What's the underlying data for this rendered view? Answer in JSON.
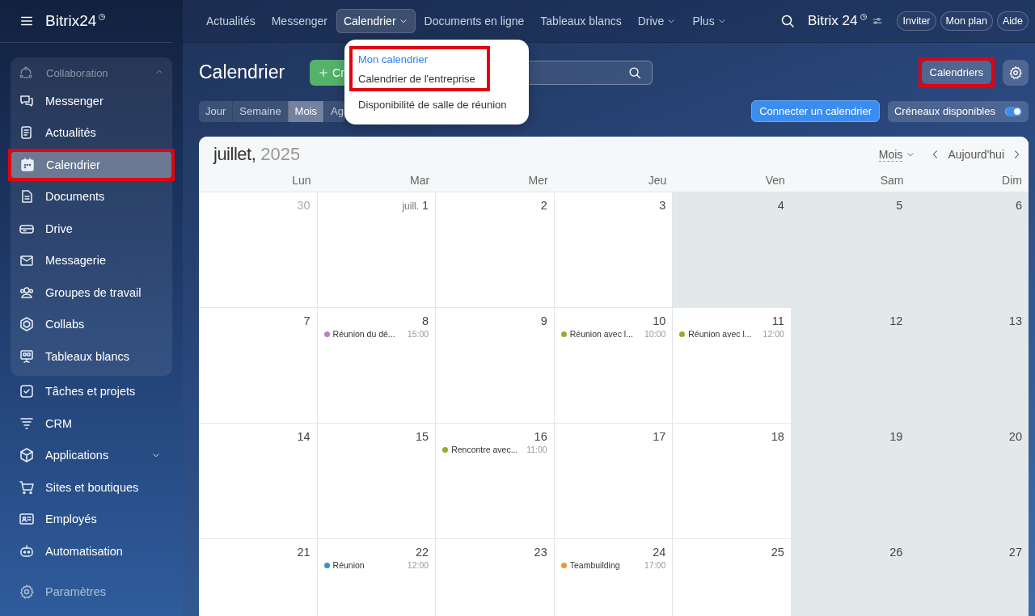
{
  "sidebar": {
    "logo": {
      "name": "Bitrix24"
    },
    "group": {
      "label": "Collaboration",
      "expanded": true,
      "items": [
        {
          "label": "Messenger",
          "selected": false,
          "highlighted": false
        },
        {
          "label": "Actualités",
          "selected": false,
          "highlighted": false
        },
        {
          "label": "Calendrier",
          "selected": true,
          "highlighted": true
        },
        {
          "label": "Documents",
          "selected": false,
          "highlighted": false
        },
        {
          "label": "Drive",
          "selected": false,
          "highlighted": false
        },
        {
          "label": "Messagerie",
          "selected": false,
          "highlighted": false
        },
        {
          "label": "Groupes de travail",
          "selected": false,
          "highlighted": false
        },
        {
          "label": "Collabs",
          "selected": false,
          "highlighted": false
        },
        {
          "label": "Tableaux blancs",
          "selected": false,
          "highlighted": false
        }
      ]
    },
    "items": [
      {
        "label": "Tâches et projets",
        "selected": false,
        "highlighted": false
      },
      {
        "label": "CRM",
        "selected": false,
        "highlighted": false
      },
      {
        "label": "Applications",
        "selected": false,
        "highlighted": false,
        "expanded": false
      },
      {
        "label": "Sites et boutiques",
        "selected": false,
        "highlighted": false
      },
      {
        "label": "Employés",
        "selected": false,
        "highlighted": false
      },
      {
        "label": "Automatisation",
        "selected": false,
        "highlighted": false
      }
    ],
    "settings": {
      "label": "Paramètres"
    }
  },
  "top_nav": {
    "items": [
      {
        "label": "Actualités",
        "selected": false,
        "has_menu": false
      },
      {
        "label": "Messenger",
        "selected": false,
        "has_menu": false
      },
      {
        "label": "Calendrier",
        "selected": true,
        "has_menu": true
      },
      {
        "label": "Documents en ligne",
        "selected": false,
        "has_menu": false
      },
      {
        "label": "Tableaux blancs",
        "selected": false,
        "has_menu": false
      },
      {
        "label": "Drive",
        "selected": false,
        "has_menu": true
      },
      {
        "label": "Plus",
        "selected": false,
        "has_menu": true
      }
    ],
    "brand": {
      "name": "Bitrix",
      "number": "24"
    },
    "buttons": [
      "Inviter",
      "Mon plan",
      "Aide"
    ]
  },
  "dropdown": {
    "items": [
      {
        "label": "Mon calendrier",
        "selected": true,
        "highlighted": true
      },
      {
        "label": "Calendrier de l'entreprise",
        "selected": false,
        "highlighted": true
      },
      {
        "label": "Disponibilité de salle de réunion",
        "selected": false,
        "highlighted": false
      }
    ]
  },
  "toolbar": {
    "title": "Calendrier",
    "create_button": "Cr",
    "calendars_button": {
      "label": "Calendriers",
      "highlighted": true
    },
    "view_tabs": [
      {
        "label": "Jour",
        "selected": false
      },
      {
        "label": "Semaine",
        "selected": false
      },
      {
        "label": "Mois",
        "selected": true
      },
      {
        "label": "Ag",
        "selected": false
      }
    ],
    "connect_button": "Connecter un calendrier",
    "slots_toggle": {
      "label": "Créneaux disponibles",
      "on": true
    }
  },
  "calendar": {
    "month": "juillet,",
    "year": "2025",
    "view": "Mois",
    "today": "Aujourd'hui",
    "weekdays": [
      "Lun",
      "Mar",
      "Mer",
      "Jeu",
      "Ven",
      "Sam",
      "Dim"
    ],
    "weeks": [
      [
        {
          "day": "30",
          "other_month": true,
          "shaded": false
        },
        {
          "day": "1",
          "month_prefix": "juill.",
          "other_month": false,
          "shaded": false
        },
        {
          "day": "2",
          "other_month": false,
          "shaded": false
        },
        {
          "day": "3",
          "other_month": false,
          "shaded": false
        },
        {
          "day": "4",
          "other_month": false,
          "shaded": true
        },
        {
          "day": "5",
          "other_month": false,
          "shaded": true
        },
        {
          "day": "6",
          "other_month": false,
          "shaded": true
        }
      ],
      [
        {
          "day": "7",
          "other_month": false,
          "shaded": false
        },
        {
          "day": "8",
          "other_month": false,
          "shaded": false,
          "events": [
            {
              "title": "Réunion du dé...",
              "time": "15:00",
              "color": "#c07ccd"
            }
          ]
        },
        {
          "day": "9",
          "other_month": false,
          "shaded": false
        },
        {
          "day": "10",
          "other_month": false,
          "shaded": false,
          "events": [
            {
              "title": "Réunion avec l...",
              "time": "10:00",
              "color": "#8fb032"
            }
          ]
        },
        {
          "day": "11",
          "other_month": false,
          "shaded": false,
          "events": [
            {
              "title": "Réunion avec l...",
              "time": "12:00",
              "color": "#8fb032"
            }
          ]
        },
        {
          "day": "12",
          "other_month": false,
          "shaded": true
        },
        {
          "day": "13",
          "other_month": false,
          "shaded": true
        }
      ],
      [
        {
          "day": "14",
          "other_month": false,
          "shaded": false
        },
        {
          "day": "15",
          "other_month": false,
          "shaded": false
        },
        {
          "day": "16",
          "other_month": false,
          "shaded": false,
          "events": [
            {
              "title": "Rencontre avec...",
              "time": "11:00",
              "color": "#8fb032"
            }
          ]
        },
        {
          "day": "17",
          "other_month": false,
          "shaded": false
        },
        {
          "day": "18",
          "other_month": false,
          "shaded": false
        },
        {
          "day": "19",
          "other_month": false,
          "shaded": true
        },
        {
          "day": "20",
          "other_month": false,
          "shaded": true
        }
      ],
      [
        {
          "day": "21",
          "other_month": false,
          "shaded": false
        },
        {
          "day": "22",
          "other_month": false,
          "shaded": false,
          "events": [
            {
              "title": "Réunion",
              "time": "12:00",
              "color": "#3d8fce"
            }
          ]
        },
        {
          "day": "23",
          "other_month": false,
          "shaded": false
        },
        {
          "day": "24",
          "other_month": false,
          "shaded": false,
          "events": [
            {
              "title": "Teambuilding",
              "time": "17:00",
              "color": "#e89b30"
            }
          ]
        },
        {
          "day": "25",
          "other_month": false,
          "shaded": false
        },
        {
          "day": "26",
          "other_month": false,
          "shaded": true
        },
        {
          "day": "27",
          "other_month": false,
          "shaded": true
        }
      ]
    ]
  }
}
